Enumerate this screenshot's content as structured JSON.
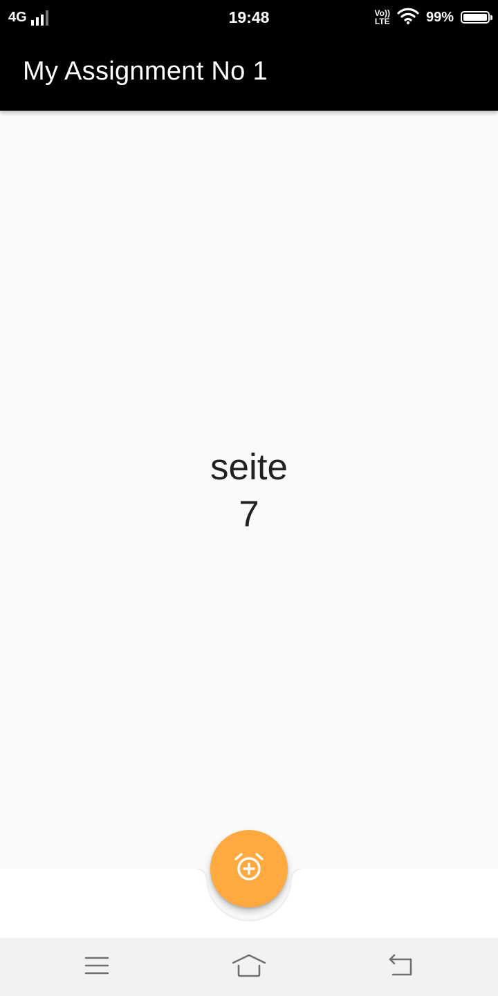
{
  "status_bar": {
    "network": "4G",
    "time": "19:48",
    "volte_top": "Vo))",
    "volte_bottom": "LTE",
    "battery_percent": "99%",
    "battery_level": 0.99,
    "icons": [
      "signal-icon",
      "wifi-icon",
      "battery-icon"
    ]
  },
  "app_bar": {
    "title": "My Assignment No 1"
  },
  "content": {
    "label": "seite",
    "page_number": "7"
  },
  "fab": {
    "icon": "alarm-add-icon",
    "color": "#FFA941"
  },
  "nav_bar": {
    "icons": [
      "menu-icon",
      "home-icon",
      "back-icon"
    ]
  }
}
